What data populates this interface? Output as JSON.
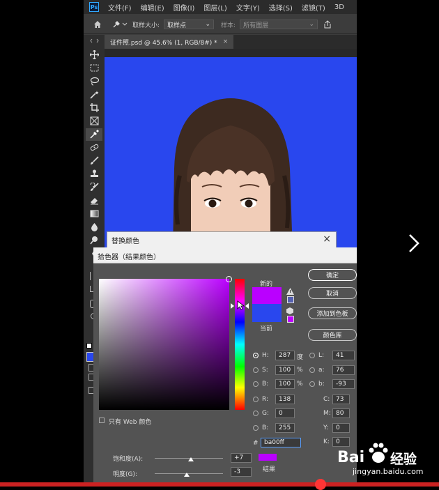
{
  "menubar": {
    "logo": "Ps",
    "items": [
      "文件(F)",
      "编辑(E)",
      "图像(I)",
      "图层(L)",
      "文字(Y)",
      "选择(S)",
      "滤镜(T)",
      "3D"
    ]
  },
  "options": {
    "sample_size_label": "取样大小:",
    "sample_size_value": "取样点",
    "sample_label": "样本:",
    "sample_value": "所有图层"
  },
  "document_tab": {
    "title": "证件照.psd @ 45.6% (1, RGB/8#) *",
    "close": "×"
  },
  "replace_color_dialog": {
    "title": "替换颜色",
    "close": "×"
  },
  "color_picker": {
    "title": "拾色器（结果颜色）",
    "new_label": "新的",
    "current_label": "当前",
    "new_color": "#ba00ff",
    "current_color": "#2947ee",
    "buttons": {
      "ok": "确定",
      "cancel": "取消",
      "add_to_swatches": "添加到色板",
      "color_libraries": "颜色库"
    },
    "hsb": {
      "h_label": "H:",
      "h_value": "287",
      "h_unit": "度",
      "s_label": "S:",
      "s_value": "100",
      "s_unit": "%",
      "b_label": "B:",
      "b_value": "100",
      "b_unit": "%"
    },
    "rgb": {
      "r_label": "R:",
      "r_value": "138",
      "g_label": "G:",
      "g_value": "0",
      "b_label": "B:",
      "b_value": "255"
    },
    "lab": {
      "l_label": "L:",
      "l_value": "41",
      "a_label": "a:",
      "a_value": "76",
      "b_label": "b:",
      "b_value": "-93"
    },
    "cmyk": {
      "c_label": "C:",
      "c_value": "73",
      "m_label": "M:",
      "m_value": "80",
      "y_label": "Y:",
      "y_value": "0",
      "k_label": "K:",
      "k_value": "0"
    },
    "hex_label": "#",
    "hex_value": "ba00ff",
    "web_only_label": "只有 Web 颜色"
  },
  "replace_sliders": {
    "saturation_label": "饱和度(A):",
    "saturation_value": "+7",
    "lightness_label": "明度(G):",
    "lightness_value": "-3",
    "result_label": "结果"
  },
  "watermark": {
    "brand": "Bai",
    "brand_cn": "经验",
    "url": "jingyan.baidu.com"
  }
}
